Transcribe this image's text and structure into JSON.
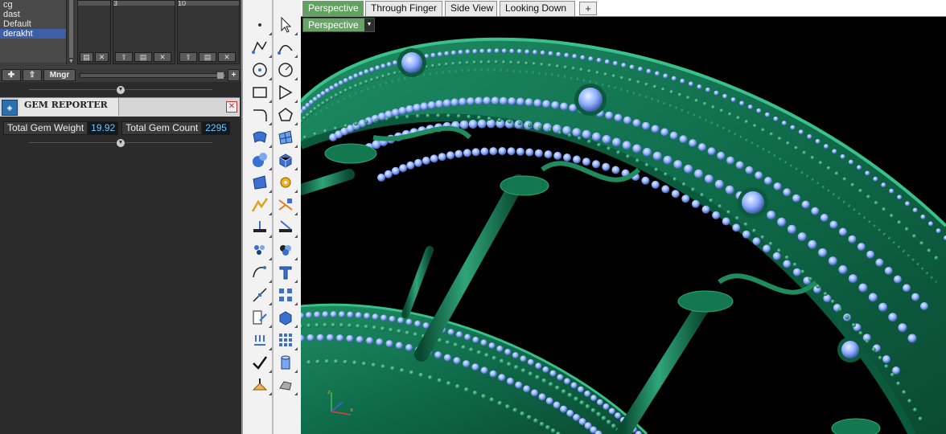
{
  "layers": {
    "items": [
      {
        "label": "cg",
        "selected": false
      },
      {
        "label": "dast",
        "selected": false
      },
      {
        "label": "Default",
        "selected": false
      },
      {
        "label": "derakht",
        "selected": true
      }
    ],
    "column_headers": [
      "",
      "3",
      "10"
    ],
    "mngr_label": "Mngr"
  },
  "gem_reporter": {
    "title": "GEM REPORTER",
    "weight_label": "Total Gem Weight",
    "weight_value": "19.92",
    "count_label": "Total Gem Count",
    "count_value": "2295"
  },
  "viewport": {
    "tabs": [
      {
        "label": "Perspective",
        "active": true
      },
      {
        "label": "Through Finger",
        "active": false
      },
      {
        "label": "Side View",
        "active": false
      },
      {
        "label": "Looking Down",
        "active": false
      }
    ],
    "add_tab_label": "+",
    "current_view": "Perspective",
    "colors": {
      "metal": "#0f6b4a",
      "metal_highlight": "#2fa57a",
      "gem": "#8fb0ff",
      "background": "#000000"
    }
  },
  "toolbar": {
    "icons": [
      "point-icon",
      "select-arrow-icon",
      "polyline-icon",
      "curve-points-icon",
      "circle-icon",
      "arc-icon",
      "rectangle-icon",
      "polygon-icon",
      "curve-icon",
      "polygon-outline-icon",
      "surface-icon",
      "surface-grid-icon",
      "sphere-icon",
      "box-icon",
      "extrude-icon",
      "gear-icon",
      "boolean-icon",
      "split-icon",
      "array-icon",
      "union-icon",
      "fillet-icon",
      "rotate-icon",
      "scale-icon",
      "text-icon",
      "gem-icon",
      "grid-icon",
      "dimension-icon",
      "cube-blue-icon",
      "align-icon",
      "matrix-icon",
      "check-icon",
      "cylinder-icon",
      "paint-icon",
      "solid-icon"
    ]
  }
}
